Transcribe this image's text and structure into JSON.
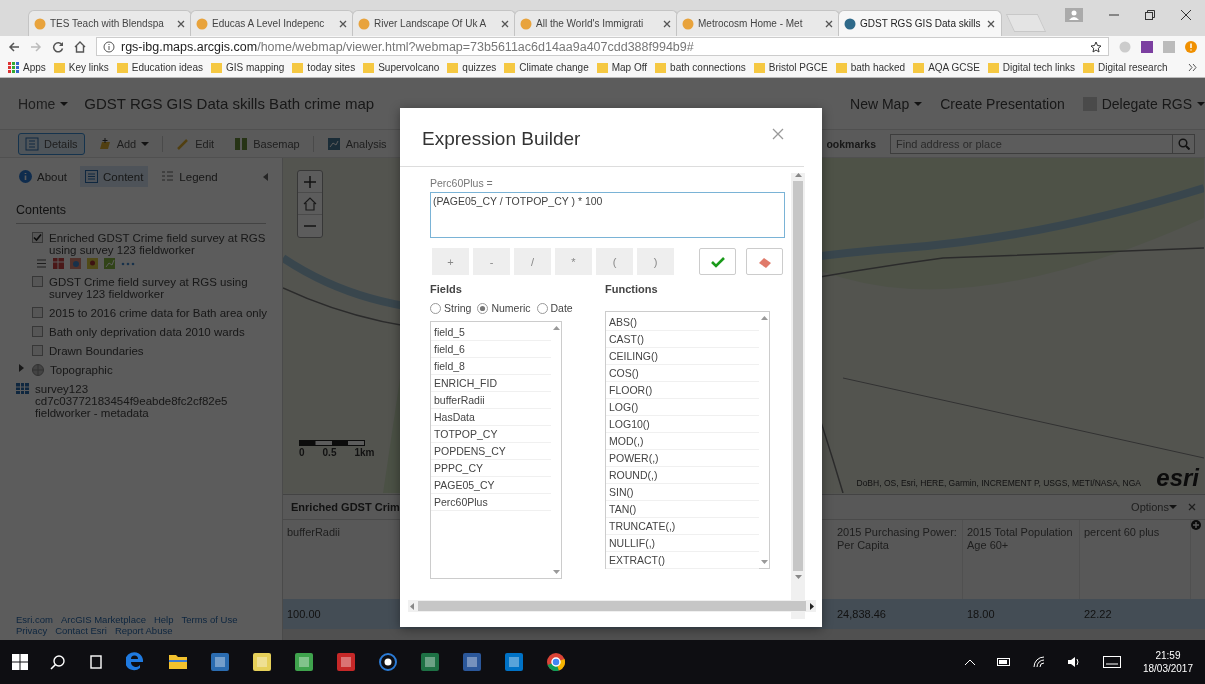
{
  "browser": {
    "tabs": [
      {
        "title": "TES Teach with Blendspa",
        "selected": false
      },
      {
        "title": "Educas A Level Indepenc",
        "selected": false
      },
      {
        "title": "River Landscape Of Uk A",
        "selected": false
      },
      {
        "title": "All the World's Immigrati",
        "selected": false
      },
      {
        "title": "Metrocosm Home - Met",
        "selected": false
      },
      {
        "title": "GDST RGS GIS Data skills",
        "selected": true
      }
    ],
    "url_host": "rgs-ibg.maps.arcgis.com",
    "url_path": "/home/webmap/viewer.html?webmap=73b5611ac6d14aa9a407cdd388f994b9#",
    "apps": "Apps",
    "bookmarks": [
      "Key links",
      "Education ideas",
      "GIS mapping",
      "today sites",
      "Supervolcano",
      "quizzes",
      "Climate change",
      "Map Off",
      "bath connections",
      "Bristol PGCE",
      "bath hacked",
      "AQA GCSE",
      "Digital tech links",
      "Digital research"
    ]
  },
  "app": {
    "home": "Home",
    "title": "GDST RGS GIS Data skills Bath crime map",
    "header_links": [
      {
        "label": "New Map",
        "dropdown": true
      },
      {
        "label": "Create Presentation",
        "dropdown": false
      },
      {
        "label": "Delegate RGS",
        "dropdown": true
      }
    ],
    "toolbar": [
      {
        "label": "Details",
        "selected": true,
        "dropdown": false
      },
      {
        "label": "Add",
        "selected": false,
        "dropdown": true
      },
      {
        "label": "Edit",
        "selected": false,
        "dropdown": false
      },
      {
        "label": "Basemap",
        "selected": false,
        "dropdown": false
      },
      {
        "label": "Analysis",
        "selected": false,
        "dropdown": false
      }
    ],
    "bookmarks_label": "ookmarks",
    "search": {
      "placeholder": "Find address or place"
    },
    "panel_tabs": [
      {
        "label": "About",
        "selected": false
      },
      {
        "label": "Content",
        "selected": true
      },
      {
        "label": "Legend",
        "selected": false
      }
    ],
    "contents_title": "Contents",
    "layers": [
      {
        "kind": "layer",
        "name": "Enriched GDST Crime field survey at RGS using survey 123 fieldworker",
        "checked": true
      },
      {
        "kind": "layer",
        "name": "GDST Crime field survey at RGS using survey 123 fieldworker",
        "checked": false
      },
      {
        "kind": "layer",
        "name": "2015 to 2016 crime data for Bath area only",
        "checked": false
      },
      {
        "kind": "layer",
        "name": "Bath only deprivation data 2010 wards",
        "checked": false
      },
      {
        "kind": "layer",
        "name": "Drawn Boundaries",
        "checked": false
      },
      {
        "kind": "group",
        "name": "Topographic",
        "expanded": false
      },
      {
        "kind": "table",
        "name": "survey123 cd7c03772183454f9eabde8fc2cf82e5 fieldworker - metadata"
      }
    ],
    "footer_links": [
      "Esri.com",
      "ArcGIS Marketplace",
      "Help",
      "Terms of Use",
      "Privacy",
      "Contact Esri",
      "Report Abuse"
    ],
    "map": {
      "scale_labels": [
        "0",
        "0.5",
        "1km"
      ],
      "attribution": "DoBH, OS, Esri, HERE, Garmin, INCREMENT P, USGS, METI/NASA, NGA",
      "logo": "esri"
    },
    "table": {
      "title": "Enriched GDST Crim",
      "options": "Options",
      "columns": [
        "bufferRadii",
        "2015 Purchasing Power: Per Capita",
        "2015 Total Population Age 60+",
        "percent 60 plus"
      ],
      "rows": [
        {
          "selected": true,
          "cells": [
            "100.00",
            "24,838.46",
            "18.00",
            "22.22"
          ]
        }
      ]
    }
  },
  "dialog": {
    "title": "Expression Builder",
    "field_label": "Perc60Plus =",
    "expression": "(PAGE05_CY / TOTPOP_CY ) * 100",
    "operators": [
      "+",
      "-",
      "/",
      "*",
      "(",
      ")"
    ],
    "fields_title": "Fields",
    "field_types": [
      {
        "label": "String",
        "selected": false
      },
      {
        "label": "Numeric",
        "selected": true
      },
      {
        "label": "Date",
        "selected": false
      }
    ],
    "fields": [
      "field_5",
      "field_6",
      "field_8",
      "ENRICH_FID",
      "bufferRadii",
      "HasData",
      "TOTPOP_CY",
      "POPDENS_CY",
      "PPPC_CY",
      "PAGE05_CY",
      "Perc60Plus"
    ],
    "functions_title": "Functions",
    "functions": [
      "ABS()",
      "CAST()",
      "CEILING()",
      "COS()",
      "FLOOR()",
      "LOG()",
      "LOG10()",
      "MOD(,)",
      "POWER(,)",
      "ROUND(,)",
      "SIN()",
      "TAN()",
      "TRUNCATE(,)",
      "NULLIF(,)",
      "EXTRACT()"
    ]
  },
  "taskbar": {
    "apps": [
      {
        "kind": "edge",
        "color": "#1f7ae0"
      },
      {
        "kind": "folder",
        "color": "#f2c12e"
      },
      {
        "kind": "tile",
        "color": "#2b6cb0"
      },
      {
        "kind": "tile",
        "color": "#e6d05a"
      },
      {
        "kind": "tile",
        "color": "#3fa34d"
      },
      {
        "kind": "tile",
        "color": "#c62828"
      },
      {
        "kind": "circle",
        "color": "#2b7bd6"
      },
      {
        "kind": "tile",
        "color": "#1e7145"
      },
      {
        "kind": "tile",
        "color": "#2b579a"
      },
      {
        "kind": "tile",
        "color": "#0072c6"
      },
      {
        "kind": "chrome",
        "color": "#db4437"
      }
    ],
    "time": "21:59",
    "date": "18/03/2017"
  }
}
